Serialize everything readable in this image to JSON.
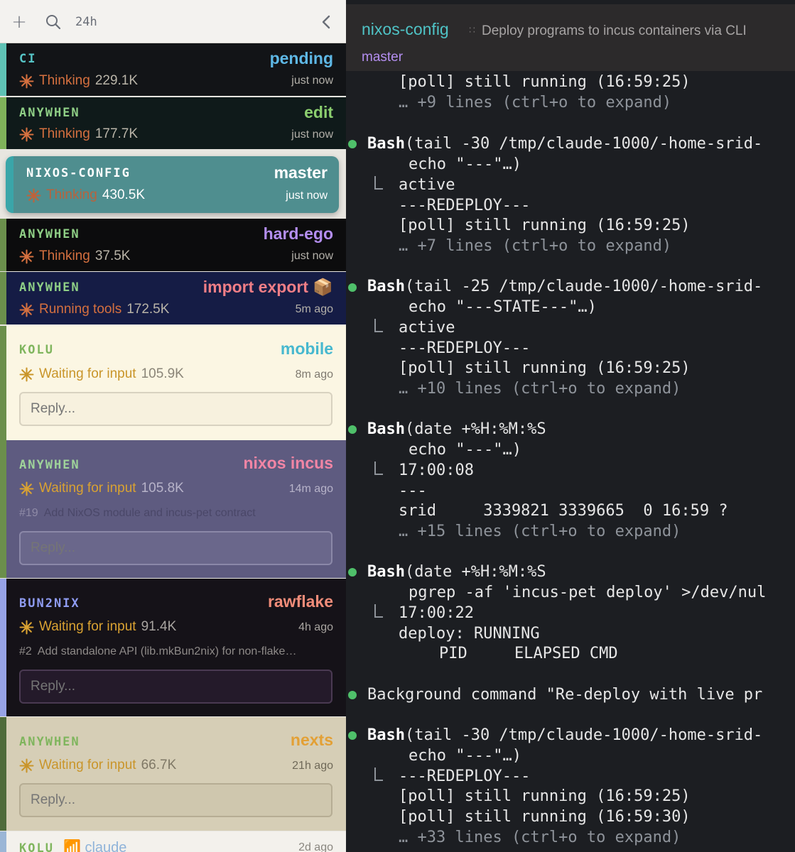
{
  "toolbar": {
    "add_icon": "plus-icon",
    "search_icon": "search-icon",
    "time_range": "24h",
    "collapse_icon": "chevron-left-icon"
  },
  "sessions": [
    {
      "repo": "CI",
      "branch": "pending",
      "status": "Thinking",
      "tokens": "229.1K",
      "time": "just now"
    },
    {
      "repo": "ANYWHEN",
      "branch": "edit",
      "status": "Thinking",
      "tokens": "177.7K",
      "time": "just now"
    },
    {
      "repo": "NIXOS-CONFIG",
      "branch": "master",
      "status": "Thinking",
      "tokens": "430.5K",
      "time": "just now"
    },
    {
      "repo": "ANYWHEN",
      "branch": "hard-ego",
      "status": "Thinking",
      "tokens": "37.5K",
      "time": "just now"
    },
    {
      "repo": "ANYWHEN",
      "branch": "import export 📦",
      "status": "Running tools",
      "tokens": "172.5K",
      "time": "5m ago"
    },
    {
      "repo": "KOLU",
      "branch": "mobile",
      "status": "Waiting for input",
      "tokens": "105.9K",
      "time": "8m ago",
      "reply_placeholder": "Reply..."
    },
    {
      "repo": "ANYWHEN",
      "branch": "nixos incus",
      "status": "Waiting for input",
      "tokens": "105.8K",
      "time": "14m ago",
      "pr_number": "#19",
      "pr_title": "Add NixOS module and incus-pet contract",
      "reply_placeholder": "Reply..."
    },
    {
      "repo": "BUN2NIX",
      "branch": "rawflake",
      "status": "Waiting for input",
      "tokens": "91.4K",
      "time": "4h ago",
      "pr_number": "#2",
      "pr_title": "Add standalone API (lib.mkBun2nix) for non-flake…",
      "reply_placeholder": "Reply..."
    },
    {
      "repo": "ANYWHEN",
      "branch": "nexts",
      "status": "Waiting for input",
      "tokens": "66.7K",
      "time": "21h ago",
      "reply_placeholder": "Reply..."
    },
    {
      "repo": "KOLU",
      "branch": "📶 claude",
      "time": "2d ago"
    }
  ],
  "terminal": {
    "title": "nixos-config",
    "separator": "∷",
    "description": "Deploy programs to incus containers via CLI",
    "branch": "master",
    "lines": [
      "[poll] still running (16:59:25)",
      "… +9 lines (ctrl+o to expand)",
      "Bash",
      "(tail -30 /tmp/claude-1000/-home-srid-",
      "echo \"---\"…)",
      "active",
      "---REDEPLOY---",
      "[poll] still running (16:59:25)",
      "… +7 lines (ctrl+o to expand)",
      "Bash",
      "(tail -25 /tmp/claude-1000/-home-srid-",
      "echo \"---STATE---\"…)",
      "active",
      "---REDEPLOY---",
      "[poll] still running (16:59:25)",
      "… +10 lines (ctrl+o to expand)",
      "Bash",
      "(date +%H:%M:%S",
      "echo \"---\"…)",
      "17:00:08",
      "---",
      "srid     3339821 3339665  0 16:59 ?",
      "… +15 lines (ctrl+o to expand)",
      "Bash",
      "(date +%H:%M:%S",
      "pgrep -af 'incus-pet deploy' >/dev/nul",
      "17:00:22",
      "deploy: RUNNING",
      "PID     ELAPSED CMD",
      "Background command \"Re-deploy with live pr",
      "Bash",
      "(tail -30 /tmp/claude-1000/-home-srid-",
      "echo \"---\"…)",
      "---REDEPLOY---",
      "[poll] still running (16:59:25)",
      "[poll] still running (16:59:30)",
      "… +33 lines (ctrl+o to expand)"
    ]
  },
  "colors": {
    "terminal_bg": "#1c1e22",
    "bullet_green": "#4fc06a",
    "accent_teal": "#4fc3c6",
    "accent_purple": "#b48ef0",
    "thinking_orange": "#d5703f",
    "waiting_amber": "#c9952a"
  }
}
